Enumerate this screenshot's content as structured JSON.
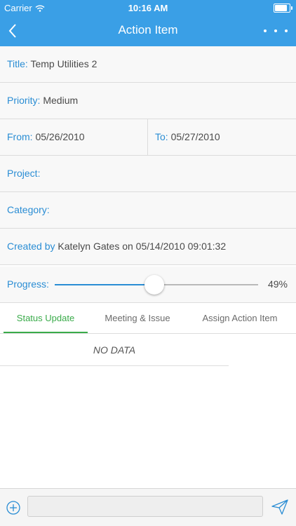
{
  "status_bar": {
    "carrier": "Carrier",
    "time": "10:16 AM"
  },
  "nav": {
    "title": "Action Item",
    "back_icon": "chevron-left-icon",
    "more_icon": "more-dots-icon"
  },
  "fields": {
    "title_label": "Title:",
    "title_value": "Temp Utilities 2",
    "priority_label": "Priority:",
    "priority_value": "Medium",
    "from_label": "From:",
    "from_value": "05/26/2010",
    "to_label": "To:",
    "to_value": "05/27/2010",
    "project_label": "Project:",
    "project_value": "",
    "category_label": "Category:",
    "category_value": "",
    "created_label": "Created by",
    "created_value": "Katelyn Gates on 05/14/2010 09:01:32"
  },
  "progress": {
    "label": "Progress:",
    "value": 49,
    "value_text": "49%"
  },
  "tabs": [
    {
      "label": "Status Update",
      "active": true
    },
    {
      "label": "Meeting & Issue",
      "active": false
    },
    {
      "label": "Assign Action Item",
      "active": false
    }
  ],
  "list": {
    "empty_text": "NO DATA"
  },
  "composer": {
    "placeholder": "",
    "add_icon": "plus-circle-icon",
    "send_icon": "send-icon"
  },
  "colors": {
    "header": "#3a9fe6",
    "label_blue": "#2a8dd4",
    "active_tab": "#3aab4a"
  }
}
